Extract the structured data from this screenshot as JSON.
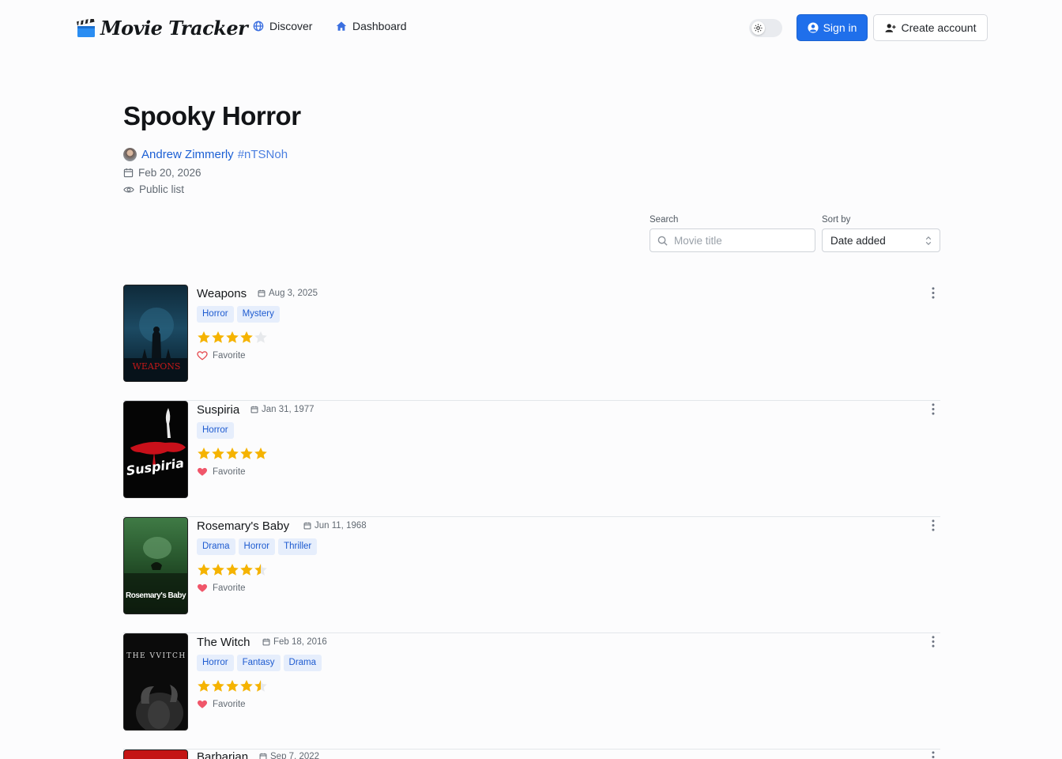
{
  "header": {
    "logo_text": "Movie Tracker",
    "nav": [
      {
        "label": "Discover",
        "icon": "globe-icon"
      },
      {
        "label": "Dashboard",
        "icon": "home-icon"
      }
    ],
    "sign_in_label": "Sign in",
    "create_account_label": "Create account",
    "accent_color": "#1f6feb"
  },
  "list": {
    "title": "Spooky Horror",
    "author_name": "Andrew Zimmerly",
    "author_tag": "#nTSNoh",
    "date": "Feb 20, 2026",
    "visibility": "Public list"
  },
  "controls": {
    "search_label": "Search",
    "search_placeholder": "Movie title",
    "search_value": "",
    "sort_label": "Sort by",
    "sort_value": "Date added"
  },
  "movies": [
    {
      "title": "Weapons",
      "date": "Aug 3, 2025",
      "genres": [
        "Horror",
        "Mystery"
      ],
      "rating": 4,
      "favorite": false,
      "favorite_label": "Favorite",
      "poster_text": "WEAPONS"
    },
    {
      "title": "Suspiria",
      "date": "Jan 31, 1977",
      "genres": [
        "Horror"
      ],
      "rating": 5,
      "favorite": true,
      "favorite_label": "Favorite",
      "poster_text": "Suspiria"
    },
    {
      "title": "Rosemary's Baby",
      "date": "Jun 11, 1968",
      "genres": [
        "Drama",
        "Horror",
        "Thriller"
      ],
      "rating": 4.5,
      "favorite": true,
      "favorite_label": "Favorite",
      "poster_text": "Rosemary's Baby"
    },
    {
      "title": "The Witch",
      "date": "Feb 18, 2016",
      "genres": [
        "Horror",
        "Fantasy",
        "Drama"
      ],
      "rating": 4.5,
      "favorite": true,
      "favorite_label": "Favorite",
      "poster_text": "THE VVITCH"
    },
    {
      "title": "Barbarian",
      "date": "Sep 7, 2022",
      "genres": [],
      "rating": 0,
      "favorite": false,
      "favorite_label": "",
      "poster_text": ""
    }
  ]
}
